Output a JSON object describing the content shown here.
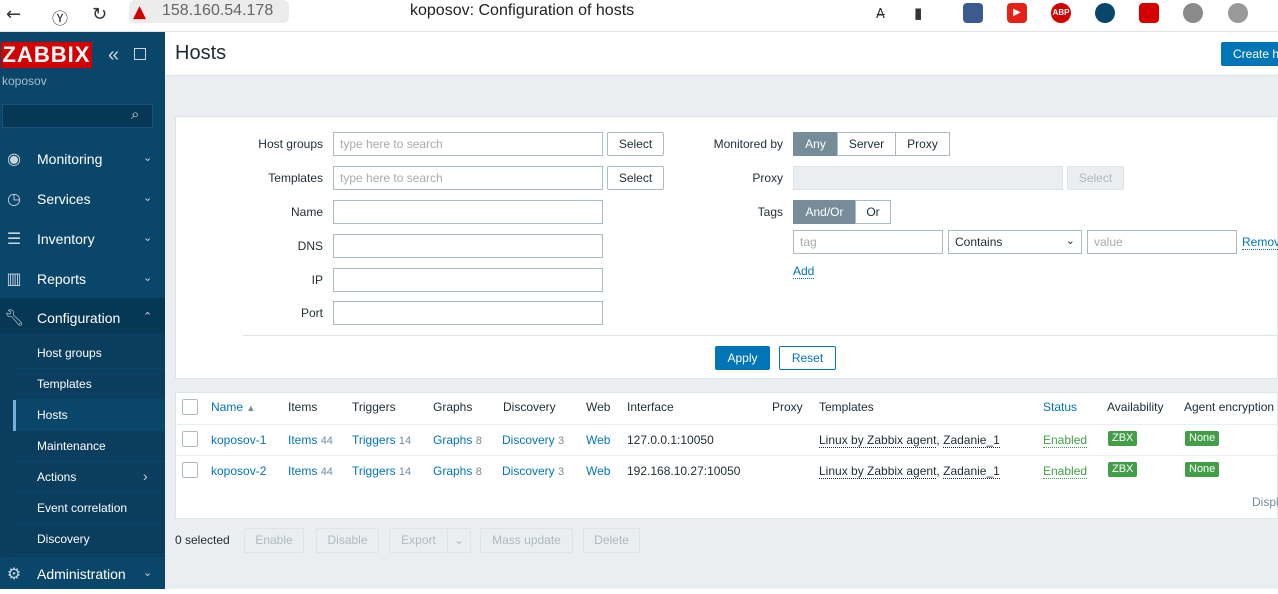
{
  "browser": {
    "back_icon": "back-arrow-icon",
    "yandex_icon": "yandex-icon",
    "reload_icon": "reload-icon",
    "url": "158.160.54.178",
    "tab_title": "koposov: Configuration of hosts",
    "extensions": [
      {
        "name": "extension-1",
        "label": ""
      },
      {
        "name": "youtube",
        "label": ""
      },
      {
        "name": "abp",
        "label": "ABP"
      },
      {
        "name": "extension-4",
        "label": ""
      },
      {
        "name": "extension-5",
        "label": ""
      },
      {
        "name": "globe",
        "label": ""
      },
      {
        "name": "extension-7",
        "label": ""
      }
    ]
  },
  "sidebar": {
    "logo": "ZABBIX",
    "username": "koposov",
    "search_placeholder": "",
    "menu": [
      {
        "label": "Monitoring",
        "icon": "eye-icon",
        "chevron": "⌄"
      },
      {
        "label": "Services",
        "icon": "stopwatch-icon",
        "chevron": "⌄"
      },
      {
        "label": "Inventory",
        "icon": "list-icon",
        "chevron": "⌄"
      },
      {
        "label": "Reports",
        "icon": "bar-chart-icon",
        "chevron": "⌄"
      },
      {
        "label": "Configuration",
        "icon": "wrench-icon",
        "chevron": "⌃"
      },
      {
        "label": "Administration",
        "icon": "gear-icon",
        "chevron": "⌄"
      }
    ],
    "submenu": [
      {
        "label": "Host groups"
      },
      {
        "label": "Templates"
      },
      {
        "label": "Hosts"
      },
      {
        "label": "Maintenance"
      },
      {
        "label": "Actions",
        "chevron": "›"
      },
      {
        "label": "Event correlation"
      },
      {
        "label": "Discovery"
      }
    ]
  },
  "header": {
    "title": "Hosts",
    "create_button": "Create h"
  },
  "filter": {
    "host_groups_label": "Host groups",
    "host_groups_placeholder": "type here to search",
    "templates_label": "Templates",
    "templates_placeholder": "type here to search",
    "select_label": "Select",
    "name_label": "Name",
    "dns_label": "DNS",
    "ip_label": "IP",
    "port_label": "Port",
    "monitored_by_label": "Monitored by",
    "monitored_by_options": [
      "Any",
      "Server",
      "Proxy"
    ],
    "monitored_by_selected": "Any",
    "proxy_label": "Proxy",
    "tags_label": "Tags",
    "tags_options": [
      "And/Or",
      "Or"
    ],
    "tags_selected": "And/Or",
    "tag_placeholder": "tag",
    "operator_value": "Contains",
    "value_placeholder": "value",
    "remove_label": "Remov",
    "add_label": "Add",
    "apply_label": "Apply",
    "reset_label": "Reset"
  },
  "table": {
    "columns": [
      "Name",
      "Items",
      "Triggers",
      "Graphs",
      "Discovery",
      "Web",
      "Interface",
      "Proxy",
      "Templates",
      "Status",
      "Availability",
      "Agent encryption"
    ],
    "sort_indicator": "▲",
    "rows": [
      {
        "name": "koposov-1",
        "items_label": "Items",
        "items_count": "44",
        "triggers_label": "Triggers",
        "triggers_count": "14",
        "graphs_label": "Graphs",
        "graphs_count": "8",
        "discovery_label": "Discovery",
        "discovery_count": "3",
        "web": "Web",
        "interface": "127.0.0.1:10050",
        "proxy": "",
        "template_1": "Linux by Zabbix agent",
        "template_sep": ",",
        "template_2": "Zadanie_1",
        "status": "Enabled",
        "availability": "ZBX",
        "encryption": "None"
      },
      {
        "name": "koposov-2",
        "items_label": "Items",
        "items_count": "44",
        "triggers_label": "Triggers",
        "triggers_count": "14",
        "graphs_label": "Graphs",
        "graphs_count": "8",
        "discovery_label": "Discovery",
        "discovery_count": "3",
        "web": "Web",
        "interface": "192.168.10.27:10050",
        "proxy": "",
        "template_1": "Linux by Zabbix agent",
        "template_sep": ",",
        "template_2": "Zadanie_1",
        "status": "Enabled",
        "availability": "ZBX",
        "encryption": "None"
      }
    ],
    "display_text": "Displa"
  },
  "actions": {
    "selected": "0 selected",
    "buttons": [
      "Enable",
      "Disable",
      "Export",
      "Mass update",
      "Delete"
    ],
    "export_menu_icon": "chevron-down-icon"
  },
  "colors": {
    "sidebar_bg": "#0a466a",
    "brand_red": "#d40000",
    "primary_blue": "#0275b8",
    "status_green": "#429e47"
  }
}
